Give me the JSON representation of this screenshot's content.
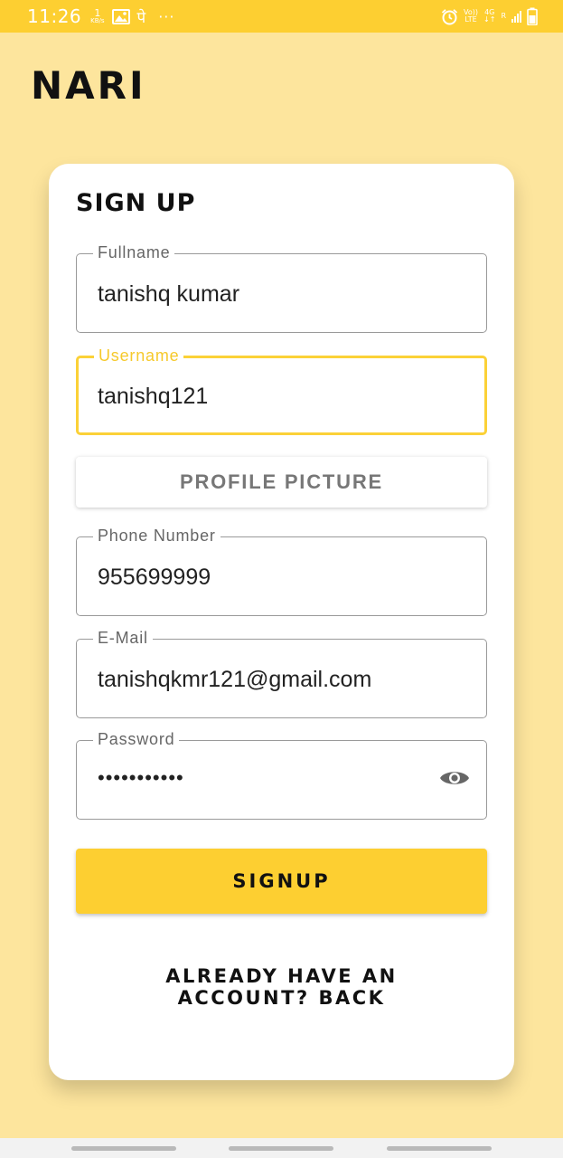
{
  "status_bar": {
    "time": "11:26",
    "data_rate_value": "1",
    "data_rate_unit": "KB/s",
    "app_glyph": "पे",
    "overflow_dots": "···",
    "network_top": "Vo))",
    "network_bottom": "LTE",
    "network_type": "4G",
    "roaming": "R",
    "icons": [
      "image-icon",
      "alarm-icon",
      "signal-icon",
      "battery-icon"
    ]
  },
  "app": {
    "title": "NARI"
  },
  "form": {
    "title": "SIGN UP",
    "fullname": {
      "label": "Fullname",
      "value": "tanishq kumar"
    },
    "username": {
      "label": "Username",
      "value": "tanishq121"
    },
    "profile_picture_label": "PROFILE PICTURE",
    "phone": {
      "label": "Phone Number",
      "value": "955699999"
    },
    "email": {
      "label": "E-Mail",
      "value": "tanishqkmr121@gmail.com"
    },
    "password": {
      "label": "Password",
      "value": "•••••••••••"
    },
    "signup_label": "SIGNUP",
    "login_prompt": "ALREADY HAVE AN ACCOUNT? BACK"
  },
  "colors": {
    "accent": "#fdcf31",
    "page_background": "#fde59d",
    "focused_border": "#fbd137"
  }
}
